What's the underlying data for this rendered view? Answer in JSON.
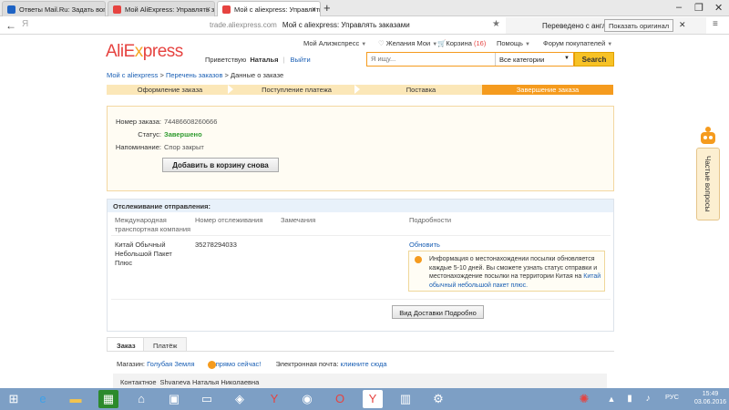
{
  "browser": {
    "tabs": [
      {
        "label": "Ответы Mail.Ru: Задать вопрос",
        "icon": "mailru-answers-icon"
      },
      {
        "label": "Мой AliExpress: Управлять за",
        "icon": "aliexpress-icon"
      },
      {
        "label": "Мой с aliexpress: Управлять",
        "icon": "aliexpress-icon"
      }
    ],
    "url_domain": "trade.aliexpress.com",
    "page_title": "Мой с aliexpress: Управлять заказами",
    "translate_text": "Переведено с английс",
    "show_original_label": "Показать оригинал",
    "search_logo": "Я"
  },
  "header": {
    "logo_ali": "AliE",
    "logo_x": "x",
    "logo_rest": "press",
    "my_ali": "Мой Алиэкспресс",
    "wishlist": "Желания Мои",
    "cart": "Корзина",
    "cart_count": "(16)",
    "help": "Помощь",
    "forum": "Форум покупателей",
    "greeting": "Приветствую",
    "user_name": "Наталья",
    "logout": "Выйти",
    "search_placeholder": "Я ищу...",
    "category": "Все категории",
    "search_button": "Search"
  },
  "breadcrumb": {
    "home": "Мой с aliexpress",
    "sep1": " > ",
    "orders": "Перечень заказов",
    "sep2": " > ",
    "current": "Данные о заказе"
  },
  "steps": [
    "Оформление заказа",
    "Поступление платежа",
    "Поставка",
    "Завершение заказа"
  ],
  "order": {
    "number_label": "Номер заказа:",
    "number_value": "74486608260666",
    "status_label": "Статус:",
    "status_value": "Завершено",
    "reminder_label": "Напоминание:",
    "reminder_value": "Спор закрыт",
    "add_to_cart": "Добавить в корзину снова",
    "status_color": "#2f9b2f"
  },
  "tracking": {
    "title": "Отслеживание отправления:",
    "col_carrier": "Международная транспортная компания",
    "col_number": "Номер отслеживания",
    "col_notes": "Замечания",
    "col_details": "Подробности",
    "carrier": "Китай Обычный Небольшой Пакет Плюс",
    "number": "35278294033",
    "refresh": "Обновить",
    "info_text": "Информация о местонахождении посылки обновляется каждые 5-10 дней. Вы сможете узнать статус отправки и местонахождение посылки на территории Китая на",
    "info_link": "Китай обычный небольшой пакет плюс.",
    "delivery_button": "Вид Доставки Подробно"
  },
  "order_tabs": [
    "Заказ",
    "Платёж"
  ],
  "shop": {
    "shop_label": "Магазин:",
    "shop_name": "Голубая Земля",
    "chat": "прямо сейчас!",
    "email_label": "Электронная почта:",
    "email_link": "кликните сюда",
    "contact_label": "Контактное",
    "contact_name": "Shvaneva Наталья Николаевна"
  },
  "faq": {
    "label": "Частые вопросы"
  },
  "taskbar": {
    "lang": "РУС",
    "time": "15:49",
    "date": "03.06.2016"
  },
  "colors": {
    "accent": "#f59b1e",
    "brand_red": "#e64340",
    "link": "#1a5fb4"
  }
}
